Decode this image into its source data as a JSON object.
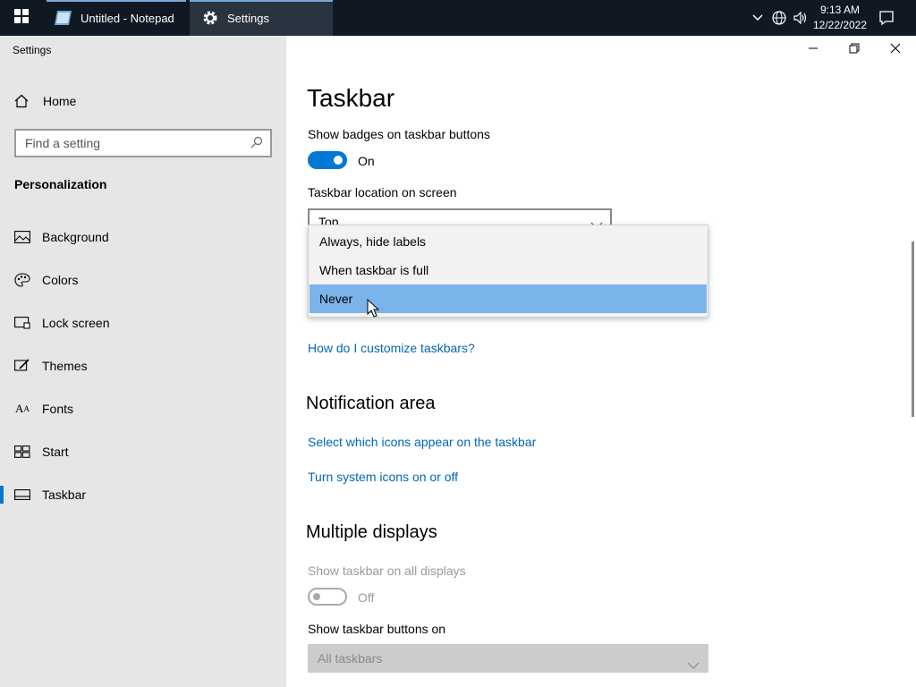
{
  "taskbar": {
    "apps": [
      {
        "label": "Untitled - Notepad",
        "icon": "notepad-icon"
      },
      {
        "label": "Settings",
        "icon": "gear-icon"
      }
    ],
    "clock": {
      "time": "9:13 AM",
      "date": "12/22/2022"
    }
  },
  "window": {
    "title": "Settings"
  },
  "sidebar": {
    "home": "Home",
    "search_placeholder": "Find a setting",
    "category": "Personalization",
    "items": [
      {
        "label": "Background",
        "icon": "picture-icon"
      },
      {
        "label": "Colors",
        "icon": "palette-icon"
      },
      {
        "label": "Lock screen",
        "icon": "lock-screen-icon"
      },
      {
        "label": "Themes",
        "icon": "brush-icon"
      },
      {
        "label": "Fonts",
        "icon": "font-icon"
      },
      {
        "label": "Start",
        "icon": "start-icon"
      },
      {
        "label": "Taskbar",
        "icon": "taskbar-icon",
        "active": true
      }
    ]
  },
  "main": {
    "title": "Taskbar",
    "badges_label": "Show badges on taskbar buttons",
    "badges_state": "On",
    "location_label": "Taskbar location on screen",
    "location_value": "Top",
    "dropdown_options": [
      "Always, hide labels",
      "When taskbar is full",
      "Never"
    ],
    "dropdown_selected": "Never",
    "customize_link": "How do I customize taskbars?",
    "notification_heading": "Notification area",
    "notif_link1": "Select which icons appear on the taskbar",
    "notif_link2": "Turn system icons on or off",
    "multi_heading": "Multiple displays",
    "show_all_label": "Show taskbar on all displays",
    "show_all_state": "Off",
    "buttons_on_label": "Show taskbar buttons on",
    "buttons_on_value": "All taskbars"
  },
  "colors": {
    "accent": "#0078d4",
    "link": "#0067b8",
    "taskbar_bg": "#101823",
    "sidebar_bg": "#e6e6e6",
    "dropdown_selected": "#7ab4ea"
  }
}
